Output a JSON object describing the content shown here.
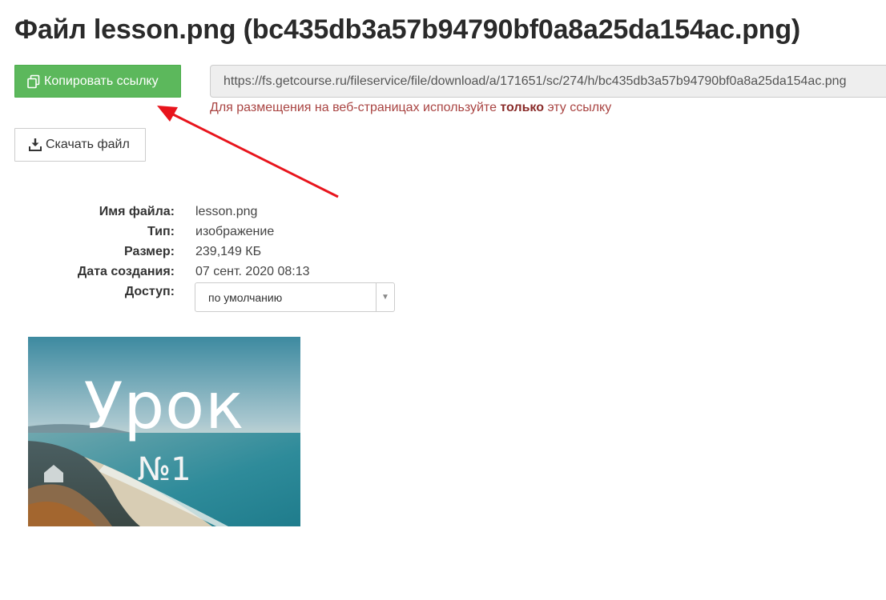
{
  "page": {
    "title": "Файл lesson.png (bc435db3a57b94790bf0a8a25da154ac.png)"
  },
  "actions": {
    "copy_label": "Копировать ссылку",
    "copy_icon": "copy-icon",
    "download_label": "Скачать файл",
    "download_icon": "download-icon"
  },
  "link": {
    "url": "https://fs.getcourse.ru/fileservice/file/download/a/171651/sc/274/h/bc435db3a57b94790bf0a8a25da154ac.png",
    "hint_before": "Для размещения на веб-страницах используйте ",
    "hint_bold": "только",
    "hint_after": " эту ссылку"
  },
  "file_info": {
    "name_label": "Имя файла:",
    "name_value": "lesson.png",
    "type_label": "Тип:",
    "type_value": "изображение",
    "size_label": "Размер:",
    "size_value": "239,149 КБ",
    "created_label": "Дата создания:",
    "created_value": "07 сент. 2020 08:13",
    "access_label": "Доступ:",
    "access_value": "по умолчанию"
  },
  "preview": {
    "title": "Урок",
    "number": "№1"
  },
  "colors": {
    "copy_button": "#5cb85c",
    "hint_text": "#a94442",
    "annotation_arrow": "#e8141c"
  }
}
